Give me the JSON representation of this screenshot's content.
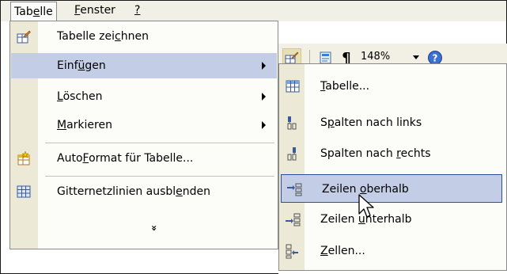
{
  "menubar": {
    "items": [
      {
        "pre": "Tab",
        "u": "e",
        "post": "lle"
      },
      {
        "pre": "",
        "u": "F",
        "post": "enster"
      },
      {
        "pre": "",
        "u": "?",
        "post": ""
      }
    ]
  },
  "toolbar": {
    "zoom_value": "148%",
    "pilcrow": "¶"
  },
  "menu": {
    "items": [
      {
        "pre": "Tabelle zei",
        "u": "c",
        "post": "hnen",
        "icon": "pencil-table-icon",
        "has_submenu": false
      },
      {
        "pre": "Einf",
        "u": "ü",
        "post": "gen",
        "icon": "",
        "has_submenu": true,
        "highlighted": true
      },
      {
        "pre": "",
        "u": "L",
        "post": "öschen",
        "icon": "",
        "has_submenu": true
      },
      {
        "pre": "",
        "u": "M",
        "post": "arkieren",
        "icon": "",
        "has_submenu": true
      },
      {
        "pre": "Auto",
        "u": "F",
        "post": "ormat für Tabelle...",
        "icon": "autoformat-icon",
        "has_submenu": false
      },
      {
        "pre": "Gitternetzlinien ausbl",
        "u": "e",
        "post": "nden",
        "icon": "gridlines-icon",
        "has_submenu": false
      }
    ],
    "more": "»"
  },
  "submenu": {
    "items": [
      {
        "pre": "",
        "u": "T",
        "post": "abelle...",
        "icon": "table-icon"
      },
      {
        "pre": "S",
        "u": "p",
        "post": "alten nach links",
        "icon": "insert-columns-left-icon"
      },
      {
        "pre": "Spalten nach ",
        "u": "r",
        "post": "echts",
        "icon": "insert-columns-right-icon"
      },
      {
        "pre": "Zeilen ",
        "u": "o",
        "post": "berhalb",
        "icon": "insert-rows-above-icon",
        "highlighted": true
      },
      {
        "pre": "Zeilen ",
        "u": "u",
        "post": "nterhalb",
        "icon": "insert-rows-below-icon"
      },
      {
        "pre": "",
        "u": "Z",
        "post": "ellen...",
        "icon": "insert-cells-icon"
      }
    ]
  },
  "colors": {
    "menubar_bg": "#f1f0e6",
    "icon_column": "#ece9d6",
    "highlight_bg": "#c3cee6",
    "highlight_border": "#2d4f99",
    "menu_bg": "#fcfcf9"
  }
}
